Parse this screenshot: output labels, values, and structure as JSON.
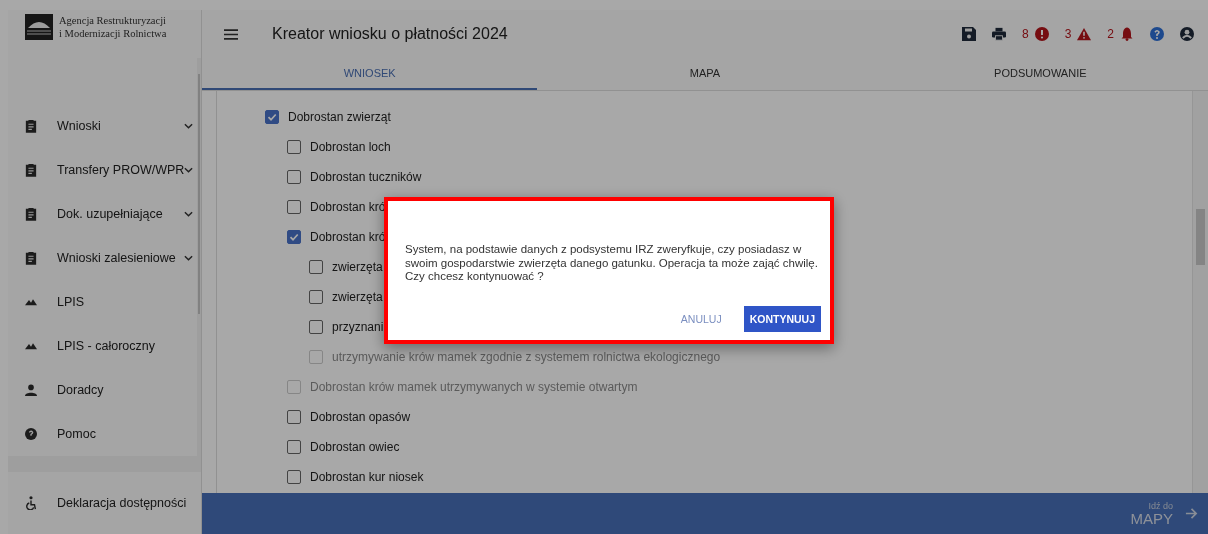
{
  "sidebar": {
    "logo_text": [
      "Agencja Restrukturyzacji",
      "i Modernizacji Rolnictwa"
    ],
    "items": [
      {
        "label": "Wnioski",
        "kind": "clipboard",
        "expandable": true
      },
      {
        "label": "Transfery PROW/WPR",
        "kind": "clipboard",
        "expandable": true
      },
      {
        "label": "Dok. uzupełniające",
        "kind": "clipboard",
        "expandable": true
      },
      {
        "label": "Wnioski zalesieniowe",
        "kind": "clipboard",
        "expandable": true
      },
      {
        "label": "LPIS",
        "kind": "terrain",
        "expandable": false
      },
      {
        "label": "LPIS - całoroczny",
        "kind": "terrain",
        "expandable": false
      },
      {
        "label": "Doradcy",
        "kind": "person",
        "expandable": false
      },
      {
        "label": "Pomoc",
        "kind": "help",
        "expandable": false
      }
    ],
    "footer": {
      "label": "Deklaracja dostępności"
    }
  },
  "header": {
    "title": "Kreator wniosku o płatności 2024",
    "indicators": [
      {
        "count": "8",
        "kind": "error"
      },
      {
        "count": "3",
        "kind": "warning"
      },
      {
        "count": "2",
        "kind": "bell"
      }
    ]
  },
  "tabs": [
    {
      "label": "WNIOSEK",
      "selected": true
    },
    {
      "label": "MAPA",
      "selected": false
    },
    {
      "label": "PODSUMOWANIE",
      "selected": false
    }
  ],
  "tree": [
    {
      "label": "Dobrostan zwierząt",
      "checked": true,
      "disabled": false,
      "children": [
        {
          "label": "Dobrostan loch",
          "checked": false,
          "disabled": false
        },
        {
          "label": "Dobrostan tuczników",
          "checked": false,
          "disabled": false
        },
        {
          "label": "Dobrostan kró",
          "checked": false,
          "disabled": false
        },
        {
          "label": "Dobrostan kró",
          "checked": true,
          "disabled": false,
          "children": [
            {
              "label": "zwierzęta",
              "checked": false,
              "disabled": false
            },
            {
              "label": "zwierzęta",
              "checked": false,
              "disabled": false
            },
            {
              "label": "przyznani",
              "checked": false,
              "disabled": false
            },
            {
              "label": "utrzymywanie krów mamek zgodnie z systemem rolnictwa ekologicznego",
              "checked": false,
              "disabled": true
            }
          ]
        },
        {
          "label": "Dobrostan krów mamek utrzymywanych w systemie otwartym",
          "checked": false,
          "disabled": true
        },
        {
          "label": "Dobrostan opasów",
          "checked": false,
          "disabled": false
        },
        {
          "label": "Dobrostan owiec",
          "checked": false,
          "disabled": false
        },
        {
          "label": "Dobrostan kur niosek",
          "checked": false,
          "disabled": false
        }
      ]
    }
  ],
  "next_bar": {
    "caption": "Idź do",
    "target": "MAPY"
  },
  "dialog": {
    "message": "System, na podstawie danych z podsystemu IRZ zweryfkuje, czy posiadasz w swoim gospodarstwie zwierzęta danego gatunku. Operacja ta może zająć chwilę. Czy chcesz kontynuować ?",
    "buttons": [
      {
        "label": "ANULUJ",
        "kind": "text"
      },
      {
        "label": "KONTYNUUJ",
        "kind": "primary"
      }
    ]
  }
}
